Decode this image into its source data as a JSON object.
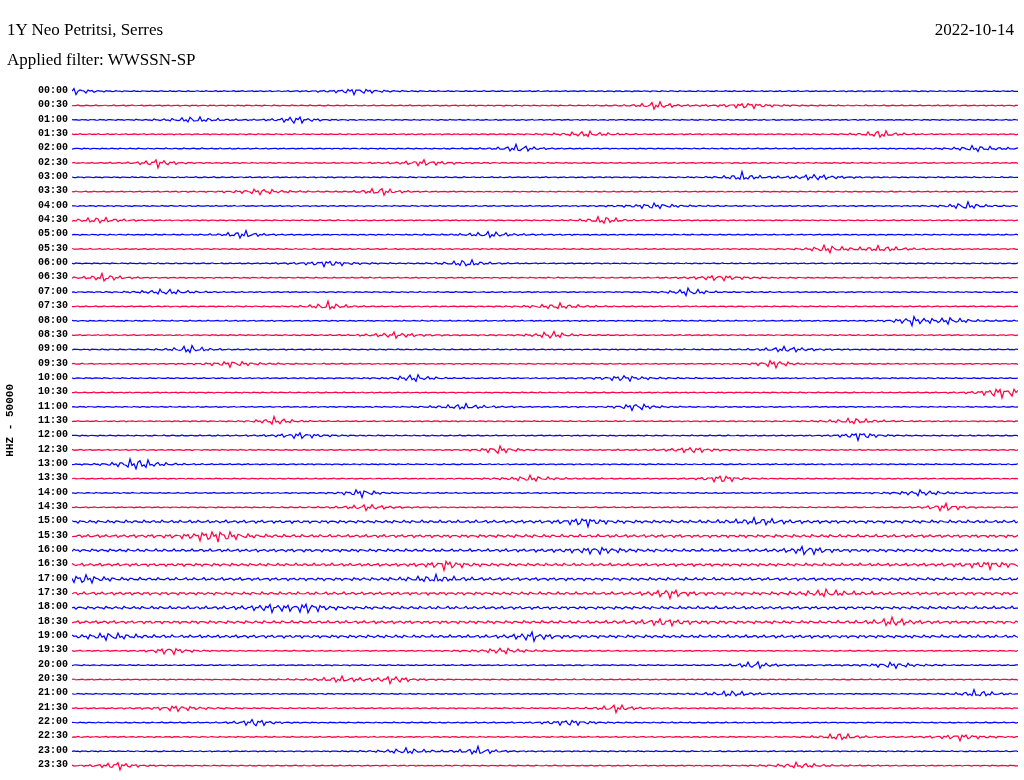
{
  "header": {
    "station": "1Y Neo Petritsi, Serres",
    "date": "2022-10-14",
    "filter": "Applied filter: WWSSN-SP"
  },
  "channel_label": "HHZ - 50000",
  "rows": [
    {
      "time": "00:00",
      "color": "#0000ff"
    },
    {
      "time": "00:30",
      "color": "#ff0040"
    },
    {
      "time": "01:00",
      "color": "#0000ff"
    },
    {
      "time": "01:30",
      "color": "#ff0040"
    },
    {
      "time": "02:00",
      "color": "#0000ff"
    },
    {
      "time": "02:30",
      "color": "#ff0040"
    },
    {
      "time": "03:00",
      "color": "#0000ff"
    },
    {
      "time": "03:30",
      "color": "#ff0040"
    },
    {
      "time": "04:00",
      "color": "#0000ff"
    },
    {
      "time": "04:30",
      "color": "#ff0040"
    },
    {
      "time": "05:00",
      "color": "#0000ff"
    },
    {
      "time": "05:30",
      "color": "#ff0040"
    },
    {
      "time": "06:00",
      "color": "#0000ff"
    },
    {
      "time": "06:30",
      "color": "#ff0040"
    },
    {
      "time": "07:00",
      "color": "#0000ff"
    },
    {
      "time": "07:30",
      "color": "#ff0040"
    },
    {
      "time": "08:00",
      "color": "#0000ff"
    },
    {
      "time": "08:30",
      "color": "#ff0040"
    },
    {
      "time": "09:00",
      "color": "#0000ff"
    },
    {
      "time": "09:30",
      "color": "#ff0040"
    },
    {
      "time": "10:00",
      "color": "#0000ff"
    },
    {
      "time": "10:30",
      "color": "#ff0040"
    },
    {
      "time": "11:00",
      "color": "#0000ff"
    },
    {
      "time": "11:30",
      "color": "#ff0040"
    },
    {
      "time": "12:00",
      "color": "#0000ff"
    },
    {
      "time": "12:30",
      "color": "#ff0040"
    },
    {
      "time": "13:00",
      "color": "#0000ff"
    },
    {
      "time": "13:30",
      "color": "#ff0040"
    },
    {
      "time": "14:00",
      "color": "#0000ff"
    },
    {
      "time": "14:30",
      "color": "#ff0040"
    },
    {
      "time": "15:00",
      "color": "#0000ff"
    },
    {
      "time": "15:30",
      "color": "#ff0040"
    },
    {
      "time": "16:00",
      "color": "#0000ff"
    },
    {
      "time": "16:30",
      "color": "#ff0040"
    },
    {
      "time": "17:00",
      "color": "#0000ff"
    },
    {
      "time": "17:30",
      "color": "#ff0040"
    },
    {
      "time": "18:00",
      "color": "#0000ff"
    },
    {
      "time": "18:30",
      "color": "#ff0040"
    },
    {
      "time": "19:00",
      "color": "#0000ff"
    },
    {
      "time": "19:30",
      "color": "#ff0040"
    },
    {
      "time": "20:00",
      "color": "#0000ff"
    },
    {
      "time": "20:30",
      "color": "#ff0040"
    },
    {
      "time": "21:00",
      "color": "#0000ff"
    },
    {
      "time": "21:30",
      "color": "#ff0040"
    },
    {
      "time": "22:00",
      "color": "#0000ff"
    },
    {
      "time": "22:30",
      "color": "#ff0040"
    },
    {
      "time": "23:00",
      "color": "#0000ff"
    },
    {
      "time": "23:30",
      "color": "#ff0040"
    }
  ]
}
